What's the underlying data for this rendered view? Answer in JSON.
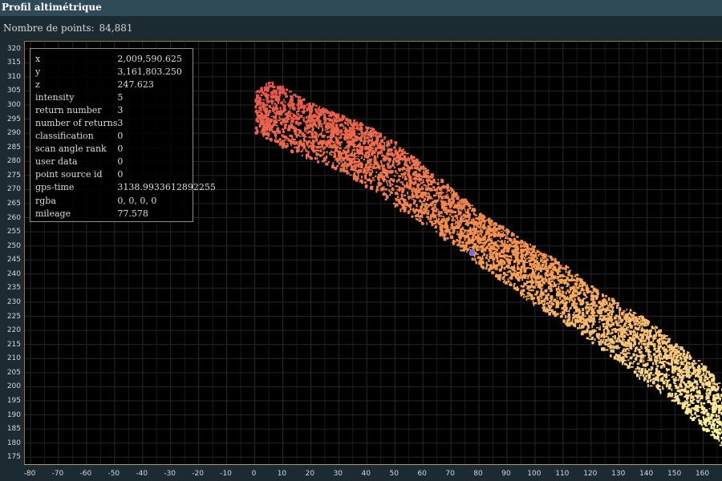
{
  "window": {
    "title": "Profil altimétrique"
  },
  "summary": {
    "label": "Nombre de points:",
    "value": "84,881"
  },
  "point_info": [
    {
      "key": "x",
      "value": "2,009,590.625"
    },
    {
      "key": "y",
      "value": "3,161,803.250"
    },
    {
      "key": "z",
      "value": "247.623"
    },
    {
      "key": "intensity",
      "value": "5"
    },
    {
      "key": "return number",
      "value": "3"
    },
    {
      "key": "number of returns",
      "value": "3"
    },
    {
      "key": "classification",
      "value": "0"
    },
    {
      "key": "scan angle rank",
      "value": "0"
    },
    {
      "key": "user data",
      "value": "0"
    },
    {
      "key": "point source id",
      "value": "0"
    },
    {
      "key": "gps-time",
      "value": "3138.9933612892255"
    },
    {
      "key": "rgba",
      "value": "0, 0, 0, 0"
    },
    {
      "key": "mileage",
      "value": "77.578"
    }
  ],
  "colors": {
    "profile_high": "#e8584a",
    "profile_mid": "#f59a52",
    "profile_low": "#fdf3a0",
    "selected_point": "#6f6cf0",
    "frame": "#8c7a3e"
  },
  "chart_data": {
    "type": "scatter",
    "title": "",
    "xlabel": "",
    "ylabel": "",
    "x_ticks": [
      "-80",
      "-70",
      "-60",
      "-50",
      "-40",
      "-30",
      "-20",
      "-10",
      "0",
      "10",
      "20",
      "30",
      "40",
      "50",
      "60",
      "70",
      "80",
      "90",
      "100",
      "110",
      "120",
      "130",
      "140",
      "150",
      "160"
    ],
    "y_ticks": [
      "320",
      "315",
      "310",
      "305",
      "300",
      "295",
      "290",
      "285",
      "280",
      "275",
      "270",
      "265",
      "260",
      "255",
      "250",
      "245",
      "240",
      "235",
      "230",
      "225",
      "220",
      "215",
      "210",
      "205",
      "200",
      "195",
      "190",
      "185",
      "180",
      "175"
    ],
    "xlim": [
      -82,
      167
    ],
    "ylim": [
      172.5,
      322.5
    ],
    "grid": true,
    "profile": {
      "x": [
        0,
        5,
        10,
        20,
        30,
        40,
        50,
        60,
        70,
        80,
        90,
        100,
        110,
        120,
        130,
        140,
        150,
        160,
        167
      ],
      "y_top": [
        305,
        309,
        307,
        301,
        297,
        293,
        287,
        279,
        271,
        262,
        256,
        250,
        244,
        236,
        230,
        224,
        216,
        208,
        200
      ],
      "y_bot": [
        290,
        288,
        285,
        281,
        277,
        271,
        264,
        258,
        251,
        243,
        236,
        229,
        223,
        216,
        209,
        201,
        194,
        185,
        178
      ]
    },
    "selected_point": {
      "x": 77.578,
      "y": 247.623
    }
  }
}
